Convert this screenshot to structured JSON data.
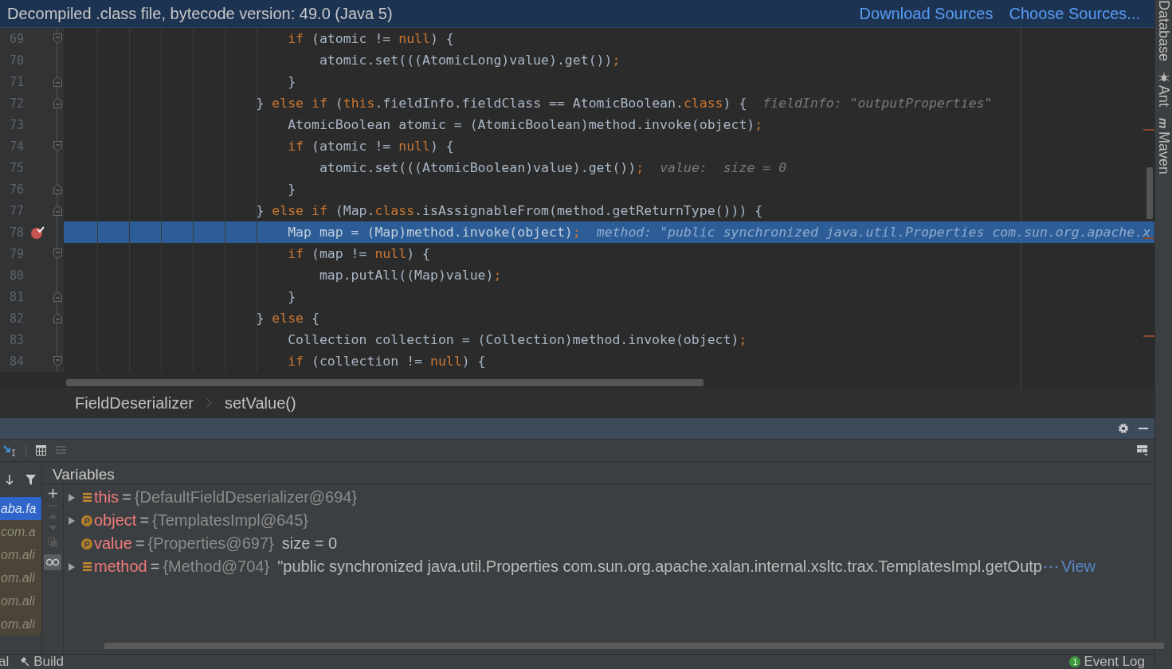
{
  "banner": {
    "text": "Decompiled .class file, bytecode version: 49.0 (Java 5)",
    "links": [
      "Download Sources",
      "Choose Sources..."
    ]
  },
  "side_tools": [
    {
      "label": "Database",
      "kind": "plain"
    },
    {
      "label": "Ant",
      "kind": "bug"
    },
    {
      "label": "Maven",
      "kind": "letter",
      "glyph": "m"
    }
  ],
  "editor": {
    "lines": [
      {
        "number": "69",
        "kind": "fold-start",
        "breakpoint": false,
        "selected": false,
        "tokens": [
          {
            "kind": "keyword",
            "text": "                            if"
          },
          {
            "kind": "plain",
            "text": " (atomic != "
          },
          {
            "kind": "keyword",
            "text": "null"
          },
          {
            "kind": "plain",
            "text": ") {"
          }
        ]
      },
      {
        "number": "70",
        "kind": "plain",
        "breakpoint": false,
        "selected": false,
        "tokens": [
          {
            "kind": "plain",
            "text": "                                atomic.set(((AtomicLong)value).get())"
          },
          {
            "kind": "keyword",
            "text": ";"
          }
        ]
      },
      {
        "number": "71",
        "kind": "fold-end",
        "breakpoint": false,
        "selected": false,
        "tokens": [
          {
            "kind": "plain",
            "text": "                            }"
          }
        ]
      },
      {
        "number": "72",
        "kind": "fold-end",
        "breakpoint": false,
        "selected": false,
        "tokens": [
          {
            "kind": "plain",
            "text": "                        } "
          },
          {
            "kind": "keyword",
            "text": "else if"
          },
          {
            "kind": "plain",
            "text": " ("
          },
          {
            "kind": "keyword",
            "text": "this"
          },
          {
            "kind": "plain",
            "text": ".fieldInfo.fieldClass == AtomicBoolean."
          },
          {
            "kind": "keyword",
            "text": "class"
          },
          {
            "kind": "plain",
            "text": ") {"
          },
          {
            "kind": "hint",
            "text": "fieldInfo: \"outputProperties\""
          }
        ]
      },
      {
        "number": "73",
        "kind": "plain",
        "breakpoint": false,
        "selected": false,
        "tokens": [
          {
            "kind": "plain",
            "text": "                            AtomicBoolean atomic = (AtomicBoolean)method.invoke(object)"
          },
          {
            "kind": "keyword",
            "text": ";"
          }
        ]
      },
      {
        "number": "74",
        "kind": "fold-start",
        "breakpoint": false,
        "selected": false,
        "tokens": [
          {
            "kind": "keyword",
            "text": "                            if"
          },
          {
            "kind": "plain",
            "text": " (atomic != "
          },
          {
            "kind": "keyword",
            "text": "null"
          },
          {
            "kind": "plain",
            "text": ") {"
          }
        ]
      },
      {
        "number": "75",
        "kind": "plain",
        "breakpoint": false,
        "selected": false,
        "tokens": [
          {
            "kind": "plain",
            "text": "                                atomic.set(((AtomicBoolean)value).get())"
          },
          {
            "kind": "keyword",
            "text": ";"
          },
          {
            "kind": "hint",
            "text": "value:  size = 0"
          }
        ]
      },
      {
        "number": "76",
        "kind": "fold-end",
        "breakpoint": false,
        "selected": false,
        "tokens": [
          {
            "kind": "plain",
            "text": "                            }"
          }
        ]
      },
      {
        "number": "77",
        "kind": "fold-end",
        "breakpoint": false,
        "selected": false,
        "tokens": [
          {
            "kind": "plain",
            "text": "                        } "
          },
          {
            "kind": "keyword",
            "text": "else if"
          },
          {
            "kind": "plain",
            "text": " (Map."
          },
          {
            "kind": "keyword",
            "text": "class"
          },
          {
            "kind": "plain",
            "text": ".isAssignableFrom(method.getReturnType())) {"
          }
        ]
      },
      {
        "number": "78",
        "kind": "plain",
        "breakpoint": true,
        "selected": true,
        "tokens": [
          {
            "kind": "plain",
            "text": "                            Map map = (Map)method.invoke(object)"
          },
          {
            "kind": "keyword",
            "text": ";"
          },
          {
            "kind": "hint",
            "text": "method: \"public synchronized java.util.Properties com.sun.org.apache.x"
          }
        ]
      },
      {
        "number": "79",
        "kind": "fold-start",
        "breakpoint": false,
        "selected": false,
        "tokens": [
          {
            "kind": "keyword",
            "text": "                            if"
          },
          {
            "kind": "plain",
            "text": " (map != "
          },
          {
            "kind": "keyword",
            "text": "null"
          },
          {
            "kind": "plain",
            "text": ") {"
          }
        ]
      },
      {
        "number": "80",
        "kind": "plain",
        "breakpoint": false,
        "selected": false,
        "tokens": [
          {
            "kind": "plain",
            "text": "                                map.putAll((Map)value)"
          },
          {
            "kind": "keyword",
            "text": ";"
          }
        ]
      },
      {
        "number": "81",
        "kind": "fold-end",
        "breakpoint": false,
        "selected": false,
        "tokens": [
          {
            "kind": "plain",
            "text": "                            }"
          }
        ]
      },
      {
        "number": "82",
        "kind": "fold-end",
        "breakpoint": false,
        "selected": false,
        "tokens": [
          {
            "kind": "plain",
            "text": "                        } "
          },
          {
            "kind": "keyword",
            "text": "else"
          },
          {
            "kind": "plain",
            "text": " {"
          }
        ]
      },
      {
        "number": "83",
        "kind": "plain",
        "breakpoint": false,
        "selected": false,
        "tokens": [
          {
            "kind": "plain",
            "text": "                            Collection collection = (Collection)method.invoke(object)"
          },
          {
            "kind": "keyword",
            "text": ";"
          }
        ]
      },
      {
        "number": "84",
        "kind": "fold-start",
        "breakpoint": false,
        "selected": false,
        "tokens": [
          {
            "kind": "keyword",
            "text": "                            if"
          },
          {
            "kind": "plain",
            "text": " (collection != "
          },
          {
            "kind": "keyword",
            "text": "null"
          },
          {
            "kind": "plain",
            "text": ") {"
          }
        ]
      }
    ]
  },
  "breadcrumb": [
    "FieldDeserializer",
    "setValue()"
  ],
  "frames": [
    {
      "text": "aba.fa",
      "selected": true
    },
    {
      "text": "com.a",
      "selected": false
    },
    {
      "text": "om.ali",
      "selected": false
    },
    {
      "text": "om.ali",
      "selected": false
    },
    {
      "text": "om.ali",
      "selected": false
    },
    {
      "text": "om.ali",
      "selected": false
    }
  ],
  "variables": {
    "title": "Variables",
    "rows": [
      {
        "expandable": true,
        "kind": "field",
        "name": "this",
        "sep": "=",
        "value": "{DefaultFieldDeserializer@694}"
      },
      {
        "expandable": true,
        "kind": "parameter",
        "name": "object",
        "sep": "=",
        "value": "{TemplatesImpl@645}"
      },
      {
        "expandable": false,
        "kind": "parameter",
        "name": "value",
        "sep": "=",
        "value": "{Properties@697}",
        "detail": "size = 0"
      },
      {
        "expandable": true,
        "kind": "field",
        "name": "method",
        "sep": "=",
        "value": "{Method@704}",
        "detail": "\"public synchronized java.util.Properties com.sun.org.apache.xalan.internal.xsltc.trax.TemplatesImpl.getOutp",
        "link": "View"
      }
    ]
  },
  "status_bar": {
    "left": "al",
    "build": "Build",
    "event_count": "1",
    "event_log": "Event Log"
  }
}
